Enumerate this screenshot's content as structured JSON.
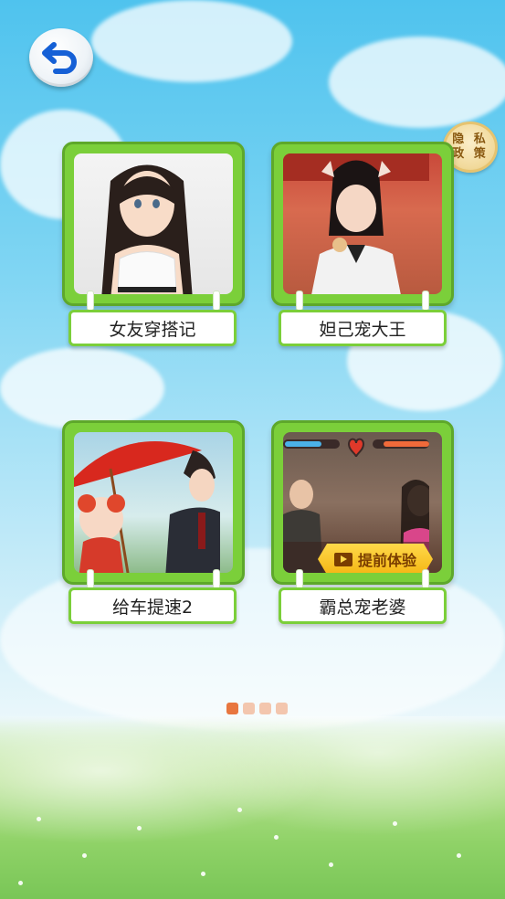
{
  "nav": {
    "back_icon": "back-arrow-icon"
  },
  "privacy": {
    "line1": "隐 私",
    "line2": "政 策"
  },
  "games": [
    {
      "title": "女友穿搭记",
      "badge": ""
    },
    {
      "title": "妲己宠大王",
      "badge": ""
    },
    {
      "title": "给车提速2",
      "badge": ""
    },
    {
      "title": "霸总宠老婆",
      "badge": "提前体验"
    }
  ],
  "pagination": {
    "total": 4,
    "current": 1
  },
  "colors": {
    "card_green": "#7bcf3a",
    "accent_orange": "#e8763f",
    "back_blue": "#1560d6"
  }
}
